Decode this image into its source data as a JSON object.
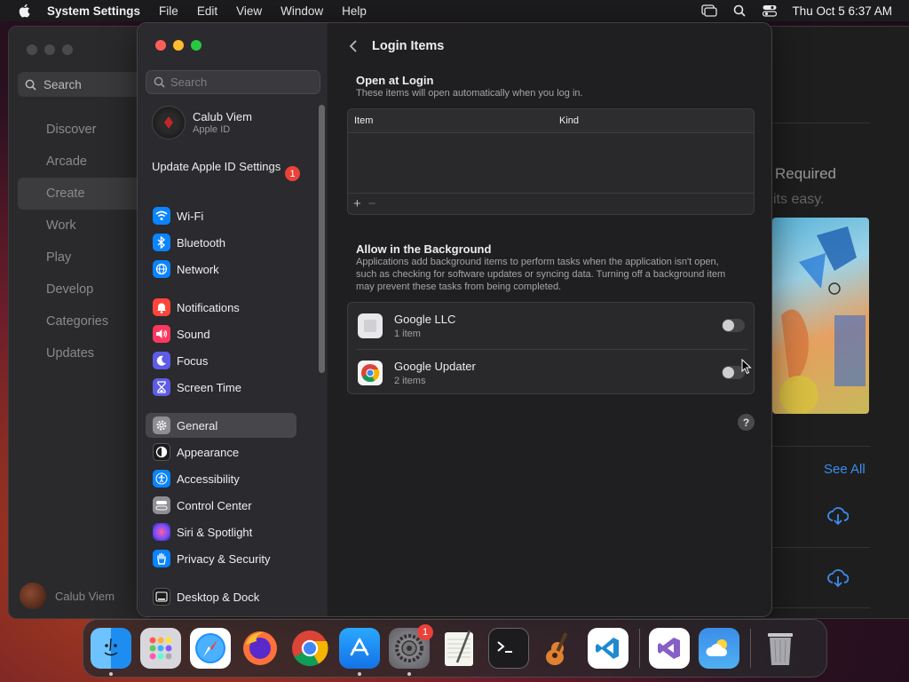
{
  "menubar": {
    "app_name": "System Settings",
    "menus": [
      "File",
      "Edit",
      "View",
      "Window",
      "Help"
    ],
    "clock": "Thu Oct 5  6:37 AM"
  },
  "background_window": {
    "search_placeholder": "Search",
    "nav": [
      "Discover",
      "Arcade",
      "Create",
      "Work",
      "Play",
      "Develop",
      "Categories",
      "Updates"
    ],
    "user_name": "Calub Viem",
    "heading_fragment": "Required",
    "subtext_fragment": "its easy.",
    "see_all": "See All"
  },
  "sidebar": {
    "search_placeholder": "Search",
    "user": {
      "name": "Calub Viem",
      "subtitle": "Apple ID"
    },
    "update": {
      "label": "Update Apple ID Settings",
      "badge": "1"
    },
    "group1": [
      {
        "label": "Wi-Fi",
        "icon": "wifi-icon",
        "color": "#0a84ff"
      },
      {
        "label": "Bluetooth",
        "icon": "bluetooth-icon",
        "color": "#0a84ff"
      },
      {
        "label": "Network",
        "icon": "globe-icon",
        "color": "#0a84ff"
      }
    ],
    "group2": [
      {
        "label": "Notifications",
        "icon": "bell-icon",
        "color": "#ff453a"
      },
      {
        "label": "Sound",
        "icon": "speaker-icon",
        "color": "#ff375f"
      },
      {
        "label": "Focus",
        "icon": "moon-icon",
        "color": "#5e5ce6"
      },
      {
        "label": "Screen Time",
        "icon": "hourglass-icon",
        "color": "#5e5ce6"
      }
    ],
    "group3": [
      {
        "label": "General",
        "icon": "gear-icon",
        "color": "#8e8e93"
      },
      {
        "label": "Appearance",
        "icon": "appearance-icon",
        "color": "#1c1c1e"
      },
      {
        "label": "Accessibility",
        "icon": "accessibility-icon",
        "color": "#0a84ff"
      },
      {
        "label": "Control Center",
        "icon": "control-center-icon",
        "color": "#8e8e93"
      },
      {
        "label": "Siri & Spotlight",
        "icon": "siri-icon",
        "color": "#bf5af2"
      },
      {
        "label": "Privacy & Security",
        "icon": "hand-icon",
        "color": "#0a84ff"
      }
    ],
    "group4": [
      {
        "label": "Desktop & Dock",
        "icon": "dock-icon",
        "color": "#1c1c1e"
      }
    ]
  },
  "content": {
    "title": "Login Items",
    "open_at_login": {
      "title": "Open at Login",
      "description": "These items will open automatically when you log in.",
      "columns": [
        "Item",
        "Kind"
      ],
      "add_label": "+",
      "remove_label": "−"
    },
    "allow_background": {
      "title": "Allow in the Background",
      "description": "Applications add background items to perform tasks when the application isn't open, such as checking for software updates or syncing data. Turning off a background item may prevent these tasks from being completed.",
      "items": [
        {
          "name": "Google LLC",
          "count": "1 item",
          "enabled": false
        },
        {
          "name": "Google Updater",
          "count": "2 items",
          "enabled": false
        }
      ]
    },
    "help_label": "?"
  },
  "dock": {
    "apps": [
      "Finder",
      "Launchpad",
      "Safari",
      "Firefox",
      "Google Chrome",
      "App Store",
      "System Settings",
      "TextEdit",
      "Terminal",
      "GarageBand",
      "Visual Studio Code",
      "Visual Studio",
      "Weather",
      "Trash"
    ],
    "settings_badge": "1"
  }
}
